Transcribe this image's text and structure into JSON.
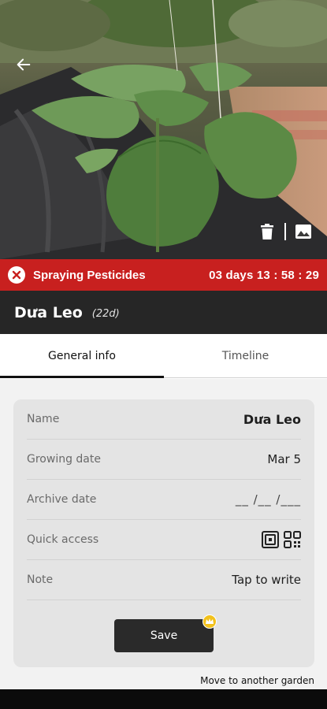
{
  "hero": {
    "image": "cucumber-seedling-photo",
    "back_icon": "arrow-left-icon",
    "delete_icon": "trash-icon",
    "gallery_icon": "image-icon"
  },
  "alert": {
    "icon": "close-circle-icon",
    "title": "Spraying Pesticides",
    "timer": "03 days 13 : 58 : 29",
    "color": "#c8201f"
  },
  "plant": {
    "name": "Dưa Leo",
    "age": "(22d)"
  },
  "tabs": [
    {
      "label": "General info",
      "active": true
    },
    {
      "label": "Timeline",
      "active": false
    }
  ],
  "info": {
    "name_label": "Name",
    "name_value": "Dưa Leo",
    "growing_label": "Growing date",
    "growing_value": "Mar 5",
    "archive_label": "Archive date",
    "archive_value": "__ /__ /___",
    "quick_label": "Quick access",
    "quick_icons": [
      "nfc-tag-icon",
      "qr-code-icon"
    ],
    "note_label": "Note",
    "note_value": "Tap to write"
  },
  "actions": {
    "save_label": "Save",
    "save_badge_icon": "crown-icon",
    "move_label": "Move to another garden"
  },
  "colors": {
    "title_bar": "#262626",
    "card": "#e4e4e4",
    "accent_badge": "#f2c11c"
  }
}
